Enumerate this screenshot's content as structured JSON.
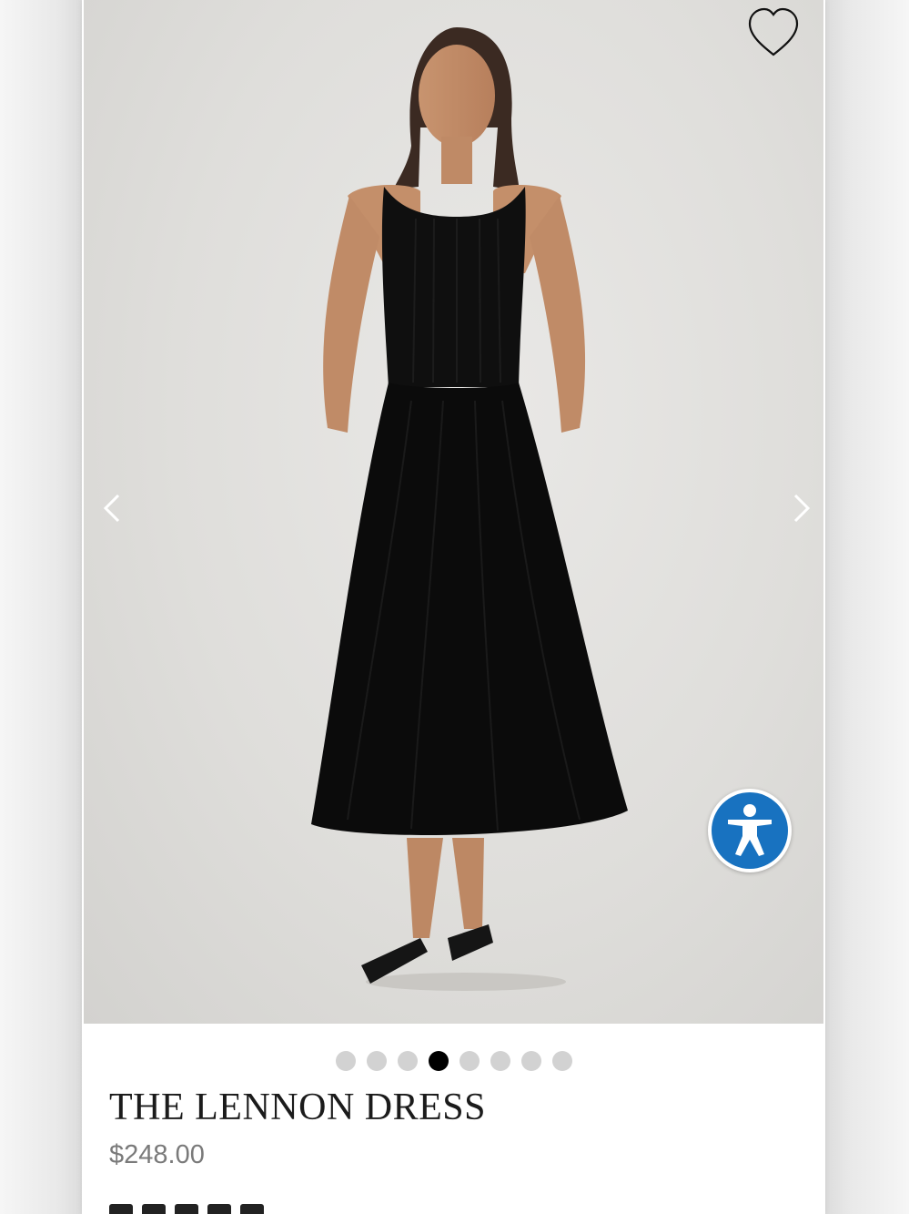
{
  "product": {
    "title": "THE LENNON DRESS",
    "price": "$248.00"
  },
  "gallery": {
    "image_count": 8,
    "active_index": 3
  },
  "icons": {
    "wishlist": "heart-outline-icon",
    "prev": "chevron-left-icon",
    "next": "chevron-right-icon",
    "accessibility": "accessibility-person-icon"
  },
  "colors": {
    "accessibility_button": "#1872c0",
    "active_dot": "#000000",
    "inactive_dot": "#d2d2d2",
    "price_text": "#7a7a7a"
  }
}
